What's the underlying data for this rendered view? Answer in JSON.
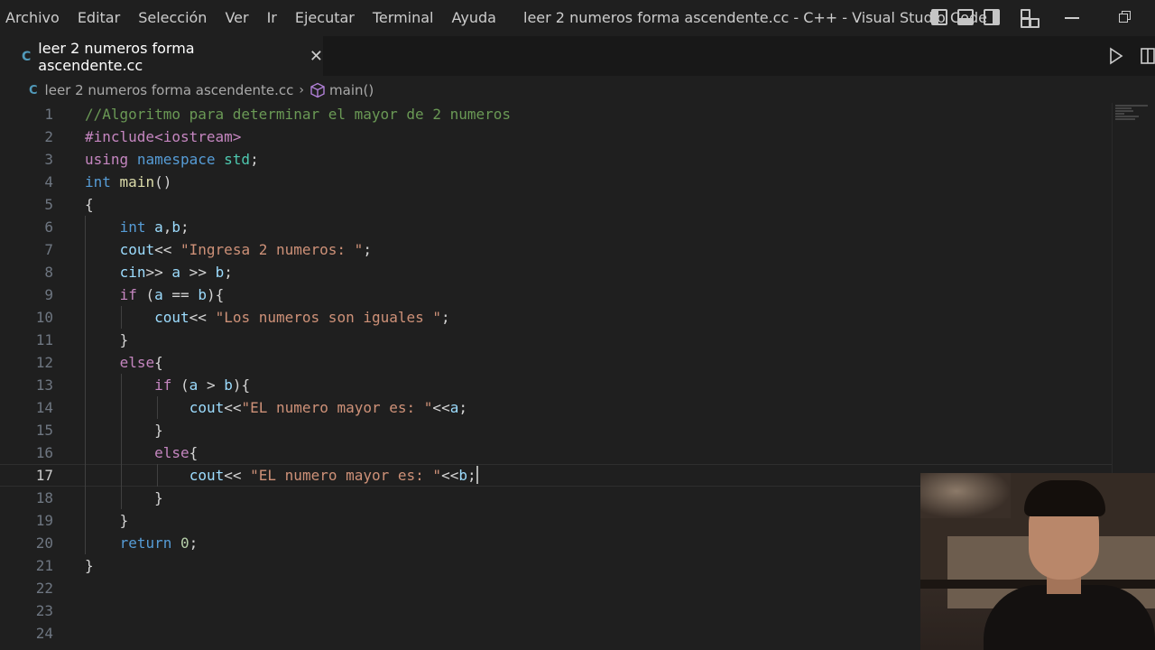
{
  "menu": [
    "Archivo",
    "Editar",
    "Selección",
    "Ver",
    "Ir",
    "Ejecutar",
    "Terminal",
    "Ayuda"
  ],
  "window_title": "leer 2 numeros forma ascendente.cc - C++ - Visual Studio Code",
  "tab": {
    "icon": "cpp-file-icon",
    "icon_glyph": "C",
    "label": "leer 2 numeros forma ascendente.cc",
    "close_glyph": "✕"
  },
  "breadcrumb": {
    "file": "leer 2 numeros forma ascendente.cc",
    "separator": "›",
    "symbol": "main()"
  },
  "editor": {
    "active_line": 17,
    "line_numbers": [
      "1",
      "2",
      "3",
      "4",
      "5",
      "6",
      "7",
      "8",
      "9",
      "10",
      "11",
      "12",
      "13",
      "14",
      "15",
      "16",
      "17",
      "18",
      "19",
      "20",
      "21",
      "22",
      "23",
      "24"
    ],
    "code_lines": [
      "//Algoritmo para determinar el mayor de 2 numeros",
      "#include<iostream>",
      "using namespace std;",
      "int main()",
      "{",
      "    int a,b;",
      "    cout<< \"Ingresa 2 numeros: \";",
      "    cin>> a >> b;",
      "    if (a == b){",
      "        cout<< \"Los numeros son iguales \";",
      "    }",
      "    else{",
      "        if (a > b){",
      "            cout<<\"EL numero mayor es: \"<<a;",
      "        }",
      "        else{",
      "            cout<< \"EL numero mayor es: \"<<b;",
      "        }",
      "    }",
      "    return 0;",
      "}",
      "",
      "",
      ""
    ]
  },
  "colors": {
    "background": "#1f1f1f",
    "comment": "#6a9955",
    "keyword": "#569cd6",
    "control": "#c586c0",
    "function": "#dcdcaa",
    "variable": "#9cdcfe",
    "namespace": "#4ec9b0",
    "string": "#ce9178",
    "number": "#b5cea8",
    "cpp_icon": "#519aba"
  }
}
